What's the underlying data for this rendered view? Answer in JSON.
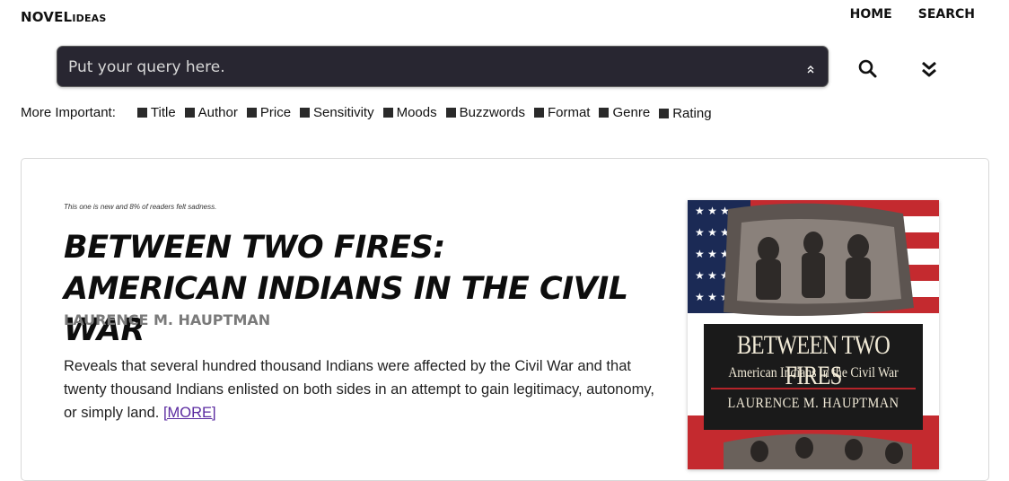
{
  "header": {
    "brand_bold": "NOVEL",
    "brand_small": "IDEAS",
    "nav": [
      "HOME",
      "SEARCH"
    ]
  },
  "search": {
    "placeholder": "Put your query here.",
    "value": ""
  },
  "filters": {
    "label": "More Important:",
    "options": [
      "Title",
      "Author",
      "Price",
      "Sensitivity",
      "Moods",
      "Buzzwords",
      "Format",
      "Genre",
      "Rating"
    ]
  },
  "result": {
    "meta": "This one is new and 8% of readers felt sadness.",
    "title": "BETWEEN TWO FIRES: AMERICAN INDIANS IN THE CIVIL WAR",
    "author": "LAURENCE M. HAUPTMAN",
    "description": "Reveals that several hundred thousand Indians were affected by the Civil War and that twenty thousand Indians enlisted on both sides in an attempt to gain legitimacy, autonomy, or simply land.",
    "more_link": "[MORE]",
    "cover": {
      "title": "BETWEEN TWO FIRES",
      "subtitle": "American Indians in the Civil War",
      "author": "LAURENCE M. HAUPTMAN"
    }
  },
  "colors": {
    "search_bg": "#282631",
    "link": "#5a2aa0",
    "author": "#7a7a7a"
  },
  "icons": [
    "search-icon",
    "double-chevron-down-icon",
    "double-chevron-up-icon"
  ]
}
